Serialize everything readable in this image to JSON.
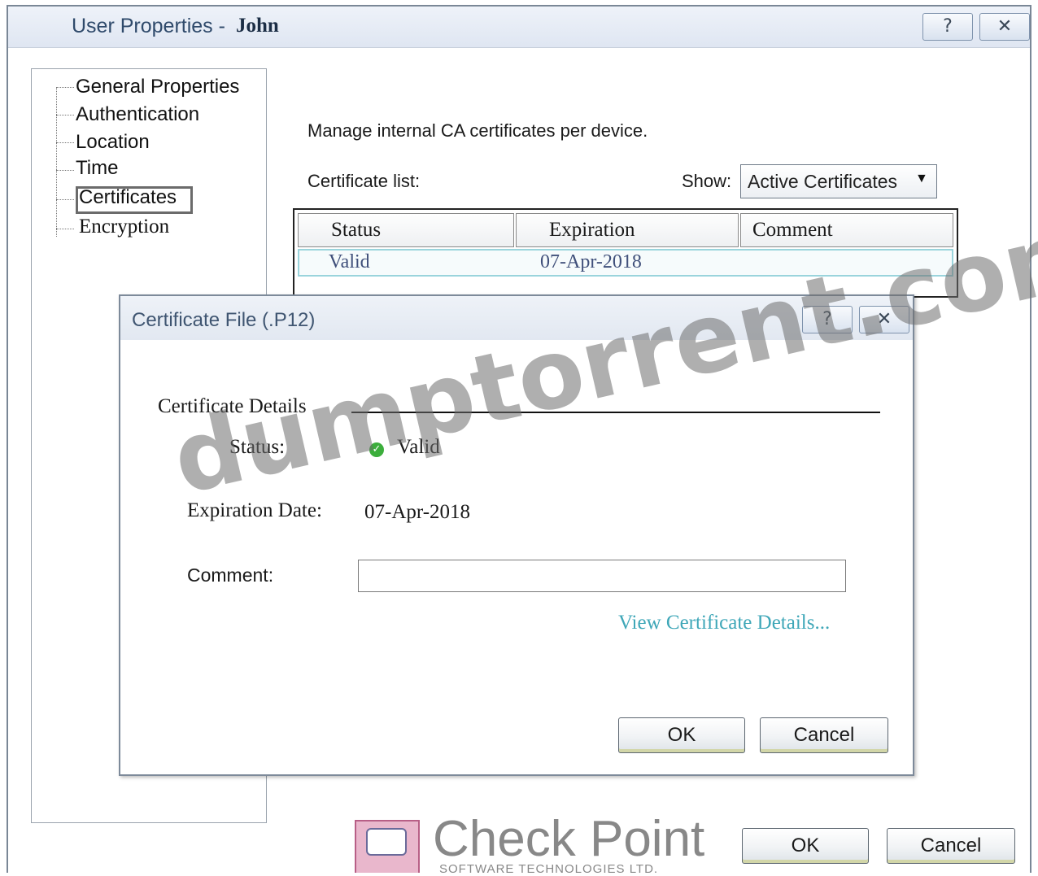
{
  "window": {
    "title_prefix": "User Properties - ",
    "title_user": "John",
    "help_glyph": "?",
    "close_glyph": "✕"
  },
  "tree": {
    "items": [
      {
        "label": "General Properties"
      },
      {
        "label": "Authentication"
      },
      {
        "label": "Location"
      },
      {
        "label": "Time"
      },
      {
        "label": "Certificates"
      },
      {
        "label": "Encryption"
      }
    ],
    "selected": "Certificates"
  },
  "content": {
    "description": "Manage internal CA certificates per device.",
    "list_label": "Certificate list:",
    "show_label": "Show:",
    "show_value": "Active Certificates"
  },
  "table": {
    "columns": [
      "Status",
      "Expiration",
      "Comment"
    ],
    "rows": [
      {
        "status": "Valid",
        "expiration": "07-Apr-2018",
        "comment": ""
      }
    ]
  },
  "dialog": {
    "title": "Certificate File (.P12)",
    "section_heading": "Certificate Details",
    "status_label": "Status:",
    "status_value": "Valid",
    "status_color": "#3cae3c",
    "expiration_label": "Expiration Date:",
    "expiration_value": "07-Apr-2018",
    "comment_label": "Comment:",
    "comment_value": "",
    "view_details_link": "View Certificate Details...",
    "ok_label": "OK",
    "cancel_label": "Cancel"
  },
  "footer": {
    "ok_label": "OK",
    "cancel_label": "Cancel"
  },
  "branding": {
    "logo_text": "Check Point",
    "logo_subtext": "SOFTWARE TECHNOLOGIES LTD.",
    "watermark": "dumptorrent.com"
  }
}
